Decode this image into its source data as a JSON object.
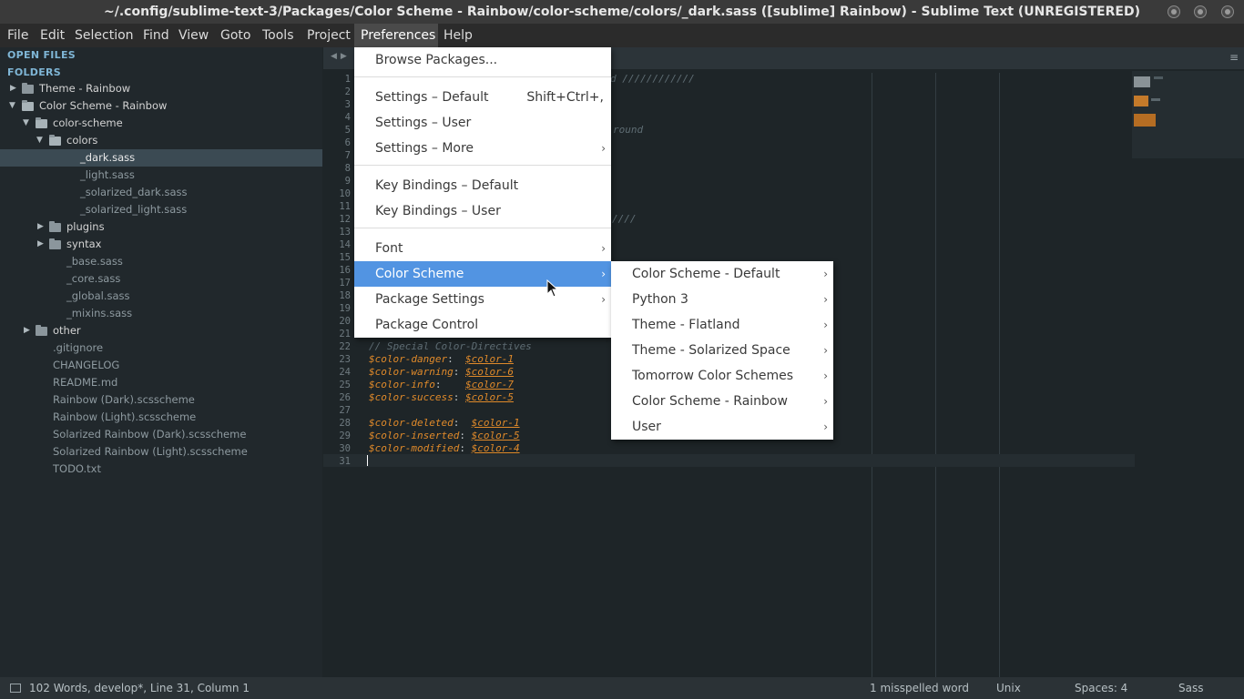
{
  "window": {
    "title": "~/.config/sublime-text-3/Packages/Color Scheme - Rainbow/color-scheme/colors/_dark.sass ([sublime] Rainbow) - Sublime Text (UNREGISTERED)"
  },
  "menubar": {
    "items": [
      "File",
      "Edit",
      "Selection",
      "Find",
      "View",
      "Goto",
      "Tools",
      "Project",
      "Preferences",
      "Help"
    ],
    "active": "Preferences"
  },
  "sidebar": {
    "open_files_label": "OPEN FILES",
    "folders_label": "FOLDERS",
    "tree": [
      {
        "label": "Theme - Rainbow",
        "kind": "folder",
        "expanded": false
      },
      {
        "label": "Color Scheme - Rainbow",
        "kind": "folder",
        "expanded": true
      },
      {
        "label": "color-scheme",
        "kind": "folder",
        "expanded": true
      },
      {
        "label": "colors",
        "kind": "folder",
        "expanded": true
      },
      {
        "label": "_dark.sass",
        "kind": "file",
        "selected": true
      },
      {
        "label": "_light.sass",
        "kind": "file"
      },
      {
        "label": "_solarized_dark.sass",
        "kind": "file"
      },
      {
        "label": "_solarized_light.sass",
        "kind": "file"
      },
      {
        "label": "plugins",
        "kind": "folder",
        "expanded": false
      },
      {
        "label": "syntax",
        "kind": "folder",
        "expanded": false
      },
      {
        "label": "_base.sass",
        "kind": "file"
      },
      {
        "label": "_core.sass",
        "kind": "file"
      },
      {
        "label": "_global.sass",
        "kind": "file"
      },
      {
        "label": "_mixins.sass",
        "kind": "file"
      },
      {
        "label": "other",
        "kind": "folder",
        "expanded": false
      },
      {
        "label": ".gitignore",
        "kind": "file"
      },
      {
        "label": "CHANGELOG",
        "kind": "file"
      },
      {
        "label": "README.md",
        "kind": "file"
      },
      {
        "label": "Rainbow (Dark).scsscheme",
        "kind": "file"
      },
      {
        "label": "Rainbow (Light).scsscheme",
        "kind": "file"
      },
      {
        "label": "Solarized Rainbow (Dark).scsscheme",
        "kind": "file"
      },
      {
        "label": "Solarized Rainbow (Light).scsscheme",
        "kind": "file"
      },
      {
        "label": "TODO.txt",
        "kind": "file"
      }
    ]
  },
  "editor": {
    "line_numbers": [
      "1",
      "2",
      "3",
      "4",
      "5",
      "6",
      "7",
      "8",
      "9",
      "10",
      "11",
      "12",
      "13",
      "14",
      "15",
      "16",
      "17",
      "18",
      "19",
      "20",
      "21",
      "22",
      "23",
      "24",
      "25",
      "26",
      "27",
      "28",
      "29",
      "30",
      "31"
    ],
    "visible_fragments": {
      "line1": "d ////////////",
      "line6": "round",
      "line12": "////"
    },
    "code": [
      {
        "line": 22,
        "comment": "// Special Color-Directives"
      },
      {
        "line": 23,
        "var": "$color-danger",
        "sep": ":  ",
        "val": "$color-1"
      },
      {
        "line": 24,
        "var": "$color-warning",
        "sep": ": ",
        "val": "$color-6"
      },
      {
        "line": 25,
        "var": "$color-info",
        "sep": ":    ",
        "val": "$color-7"
      },
      {
        "line": 26,
        "var": "$color-success",
        "sep": ": ",
        "val": "$color-5"
      },
      {
        "line": 28,
        "var": "$color-deleted",
        "sep": ":  ",
        "val": "$color-1"
      },
      {
        "line": 29,
        "var": "$color-inserted",
        "sep": ": ",
        "val": "$color-5"
      },
      {
        "line": 30,
        "var": "$color-modified",
        "sep": ": ",
        "val": "$color-4"
      }
    ],
    "tab_nav_icon": "tab-nav-arrows-icon",
    "menu_icon": "hamburger-icon"
  },
  "preferences_menu": {
    "items": [
      {
        "label": "Browse Packages..."
      },
      {
        "separator": true
      },
      {
        "label": "Settings – Default",
        "shortcut": "Shift+Ctrl+,"
      },
      {
        "label": "Settings – User"
      },
      {
        "label": "Settings – More",
        "submenu": true
      },
      {
        "separator": true
      },
      {
        "label": "Key Bindings – Default"
      },
      {
        "label": "Key Bindings – User"
      },
      {
        "separator": true
      },
      {
        "label": "Font",
        "submenu": true
      },
      {
        "label": "Color Scheme",
        "submenu": true,
        "highlighted": true
      },
      {
        "label": "Package Settings",
        "submenu": true
      },
      {
        "label": "Package Control"
      }
    ]
  },
  "color_scheme_submenu": {
    "items": [
      "Color Scheme - Default",
      "Python 3",
      "Theme - Flatland",
      "Theme - Solarized Space",
      "Tomorrow Color Schemes",
      "Color Scheme - Rainbow",
      "User"
    ]
  },
  "statusbar": {
    "left": "102 Words, develop*, Line 31, Column 1",
    "spell": "1 misspelled word",
    "line_endings": "Unix",
    "indent": "Spaces: 4",
    "syntax": "Sass"
  },
  "colors": {
    "highlight": "#5294e2",
    "code_orange": "#e08a2a",
    "sidebar_bg": "#21282c",
    "editor_bg": "#1e2528"
  }
}
